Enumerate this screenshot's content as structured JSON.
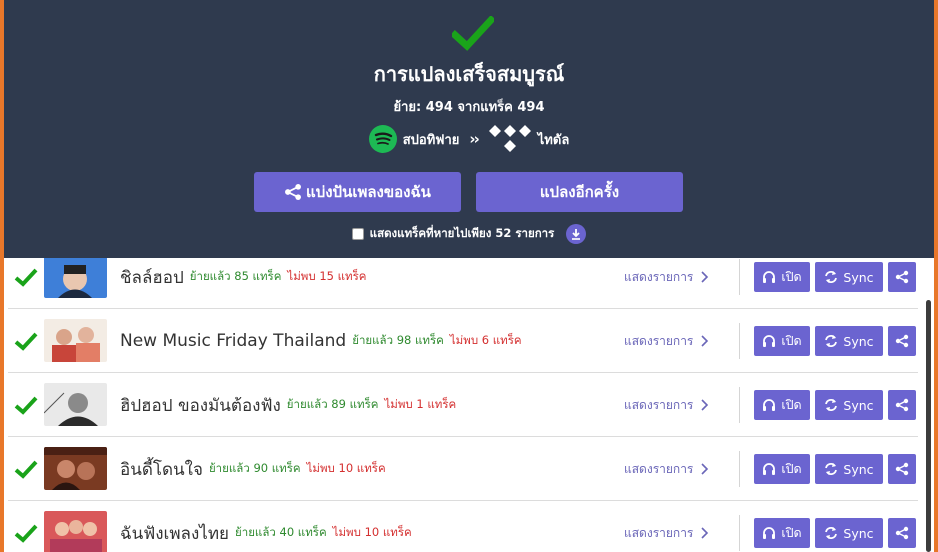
{
  "header": {
    "title": "การแปลงเสร็จสมบูรณ์",
    "summary": "ย้าย: 494 จากแทร็ค 494",
    "source_name": "สปอทิฟาย",
    "target_name": "ไทดัล",
    "source_icon": "spotify-icon",
    "target_icon": "tidal-icon",
    "share_button": "แบ่งปันเพลงของฉัน",
    "convert_again_button": "แปลงอีกครั้ง",
    "missing_label": "แสดงแทร็คที่หายไปเพียง 52 รายการ",
    "accent_color": "#6b64d0",
    "success_color": "#1aa31a"
  },
  "rows": [
    {
      "name": "ชิลล์ฮอป",
      "moved": "ย้ายแล้ว 85 แทร็ค",
      "not_found": "ไม่พบ 15 แทร็ค",
      "show": "แสดงรายการ",
      "open": "เปิด",
      "sync": "Sync"
    },
    {
      "name": "New Music Friday Thailand",
      "moved": "ย้ายแล้ว 98 แทร็ค",
      "not_found": "ไม่พบ 6 แทร็ค",
      "show": "แสดงรายการ",
      "open": "เปิด",
      "sync": "Sync"
    },
    {
      "name": "ฮิปฮอป ของมันต้องฟัง",
      "moved": "ย้ายแล้ว 89 แทร็ค",
      "not_found": "ไม่พบ 1 แทร็ค",
      "show": "แสดงรายการ",
      "open": "เปิด",
      "sync": "Sync"
    },
    {
      "name": "อินดี้โดนใจ",
      "moved": "ย้ายแล้ว 90 แทร็ค",
      "not_found": "ไม่พบ 10 แทร็ค",
      "show": "แสดงรายการ",
      "open": "เปิด",
      "sync": "Sync"
    },
    {
      "name": "ฉันฟังเพลงไทย",
      "moved": "ย้ายแล้ว 40 แทร็ค",
      "not_found": "ไม่พบ 10 แทร็ค",
      "show": "แสดงรายการ",
      "open": "เปิด",
      "sync": "Sync"
    }
  ]
}
